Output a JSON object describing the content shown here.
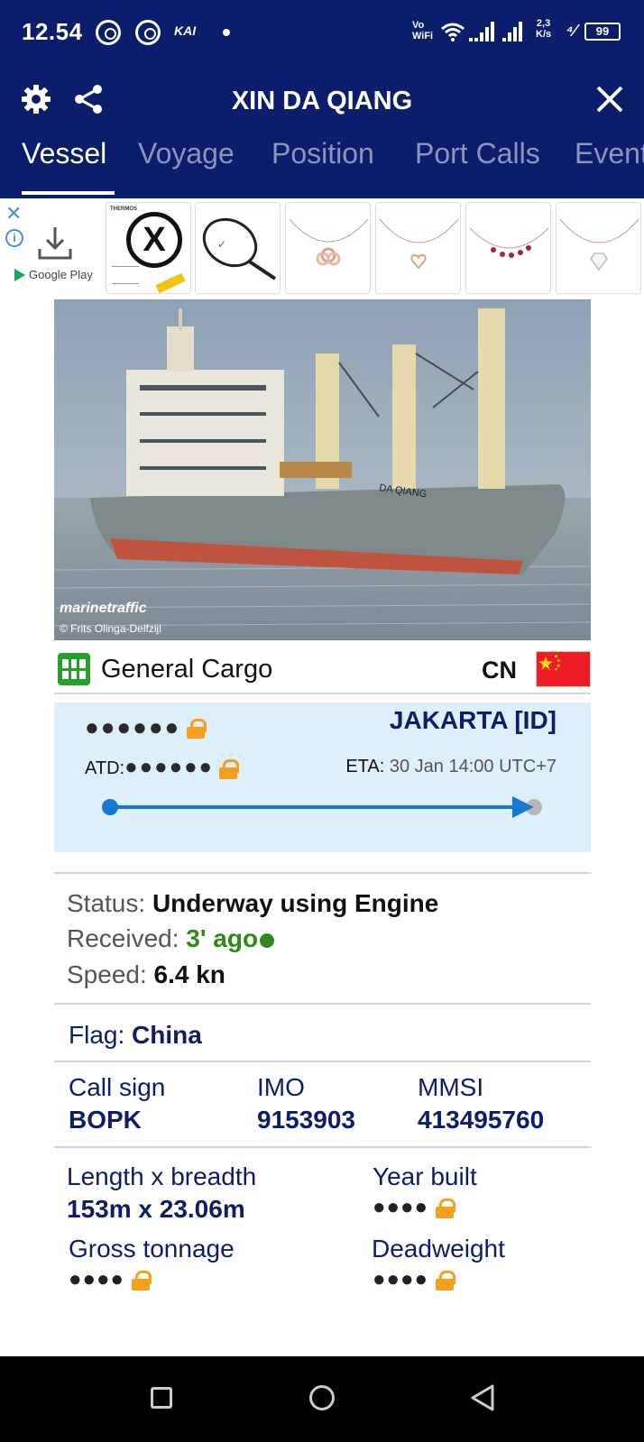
{
  "status_bar": {
    "time": "12.54",
    "carrier_label": "KAI",
    "vowifi_top": "Vo",
    "vowifi_bottom": "WiFi",
    "net_speed_value": "2,3",
    "net_speed_unit": "K/s",
    "battery": "99"
  },
  "header": {
    "title": "XIN DA QIANG",
    "tabs": [
      {
        "label": "Vessel",
        "active": true
      },
      {
        "label": "Voyage",
        "active": false
      },
      {
        "label": "Position",
        "active": false
      },
      {
        "label": "Port Calls",
        "active": false
      },
      {
        "label": "Events",
        "active": false
      }
    ]
  },
  "ad": {
    "store_label": "Google Play",
    "card1_brand": "THERMOS"
  },
  "photo": {
    "brand": "marinetraffic",
    "credit": "© Frits Olinga-Delfzijl",
    "hull_name": "DA QIANG"
  },
  "vessel": {
    "type": "General Cargo",
    "country_code": "CN"
  },
  "voyage": {
    "origin_masked": "●●●●●●",
    "destination": "JAKARTA [ID]",
    "atd_label": "ATD:",
    "atd_masked": "●●●●●●",
    "eta_label": "ETA:",
    "eta_value": "30 Jan 14:00 UTC+7",
    "progress": 1.0
  },
  "status": {
    "status_label": "Status:",
    "status_value": "Underway using Engine",
    "received_label": "Received:",
    "received_value": "3' ago",
    "speed_label": "Speed:",
    "speed_value": "6.4 kn"
  },
  "flag": {
    "label": "Flag:",
    "value": "China"
  },
  "identifiers": {
    "callsign_label": "Call sign",
    "callsign_value": "BOPK",
    "imo_label": "IMO",
    "imo_value": "9153903",
    "mmsi_label": "MMSI",
    "mmsi_value": "413495760"
  },
  "dimensions": {
    "length_label": "Length x breadth",
    "length_value": "153m x 23.06m",
    "year_label": "Year built",
    "year_masked": "●●●●",
    "gross_label": "Gross tonnage",
    "gross_masked": "●●●●",
    "dwt_label": "Deadweight",
    "dwt_masked": "●●●●"
  },
  "colors": {
    "header_bg": "#0b1d6b",
    "accent_green": "#2f8a1a",
    "lock_orange": "#f5a01a",
    "voyage_bg": "#ddeffb",
    "track_blue": "#1677d4"
  }
}
